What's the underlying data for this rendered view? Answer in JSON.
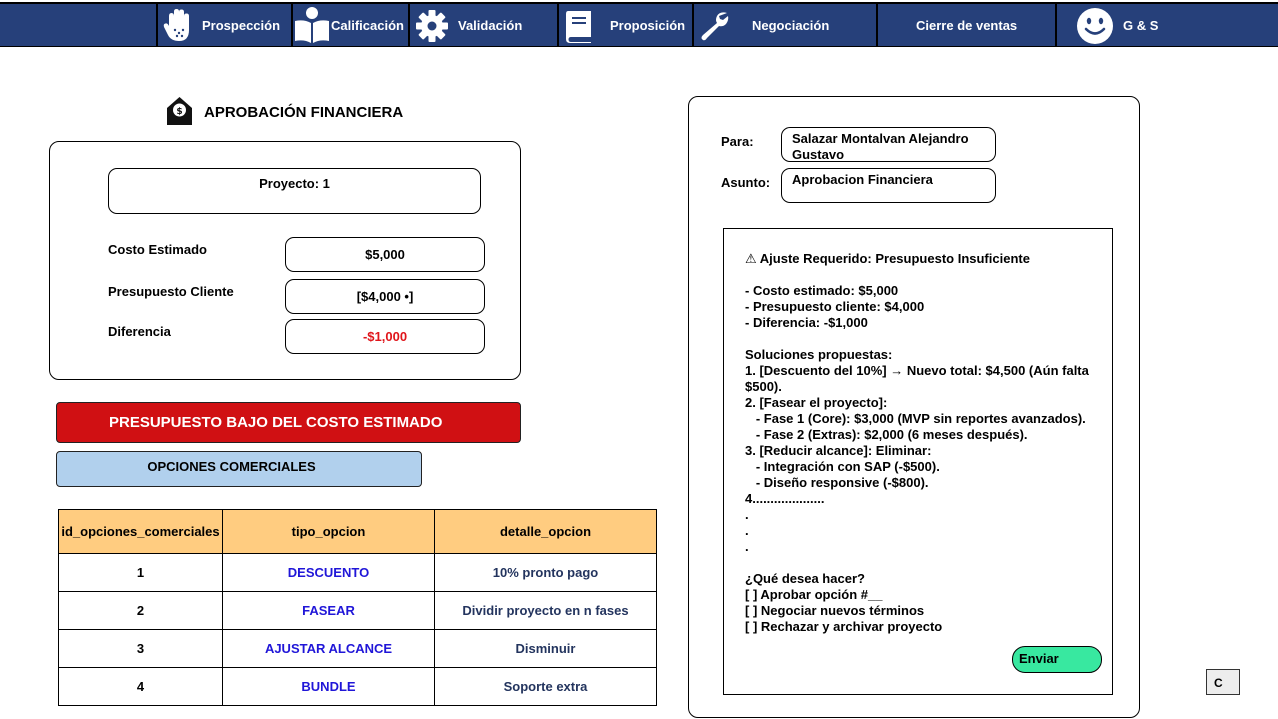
{
  "nav": {
    "items": [
      {
        "label": "Prospección",
        "icon": "hand-icon"
      },
      {
        "label": "Calificación",
        "icon": "reader-icon"
      },
      {
        "label": "Validación",
        "icon": "gear-icon"
      },
      {
        "label": "Proposición",
        "icon": "book-icon"
      },
      {
        "label": "Negociación",
        "icon": "wrench-icon"
      },
      {
        "label": "Cierre de ventas",
        "icon": ""
      }
    ],
    "user": {
      "label": "G & S",
      "icon": "smiley-icon"
    },
    "colors": {
      "background": "#26407a",
      "text": "#ffffff"
    }
  },
  "approval": {
    "title": "APROBACIÓN FINANCIERA",
    "icon": "money-tag-icon",
    "project_label": "Proyecto: 1",
    "rows": [
      {
        "label": "Costo Estimado",
        "value": "$5,000"
      },
      {
        "label": "Presupuesto Cliente",
        "value": "[$4,000 •]"
      },
      {
        "label": "Diferencia",
        "value": "-$1,000"
      }
    ],
    "difference_color": "#e0151a"
  },
  "alert": {
    "text": "PRESUPUESTO BAJO DEL COSTO ESTIMADO",
    "color": "#d01013"
  },
  "options": {
    "title": "OPCIONES COMERCIALES",
    "columns": [
      "id_opciones_comerciales",
      "tipo_opcion",
      "detalle_opcion"
    ],
    "rows": [
      [
        "1",
        "DESCUENTO",
        "10% pronto pago"
      ],
      [
        "2",
        "FASEAR",
        "Dividir proyecto en n fases"
      ],
      [
        "3",
        "AJUSTAR ALCANCE",
        "Disminuir"
      ],
      [
        "4",
        "BUNDLE",
        "Soporte extra"
      ]
    ]
  },
  "mail": {
    "to_label": "Para:",
    "to_value": "Salazar Montalvan Alejandro Gustavo",
    "subject_label": "Asunto:",
    "subject_value": "Aprobacion Financiera",
    "body": "⚠ Ajuste Requerido: Presupuesto Insuficiente\n\n- Costo estimado: $5,000\n- Presupuesto cliente: $4,000\n- Diferencia: -$1,000\n\nSoluciones propuestas:\n1. [Descuento del 10%] → Nuevo total: $4,500 (Aún falta $500).\n2. [Fasear el proyecto]:\n   - Fase 1 (Core): $3,000 (MVP sin reportes avanzados).\n   - Fase 2 (Extras): $2,000 (6 meses después).\n3. [Reducir alcance]: Eliminar:\n   - Integración con SAP (-$500).\n   - Diseño responsive (-$800).\n4....................\n.\n.\n.\n\n¿Qué desea hacer?\n[ ] Aprobar opción #__\n[ ] Negociar nuevos términos\n[ ] Rechazar y archivar proyecto",
    "send_label": "Enviar",
    "send_color": "#38e8a0"
  },
  "corner_button": {
    "label": "C"
  }
}
